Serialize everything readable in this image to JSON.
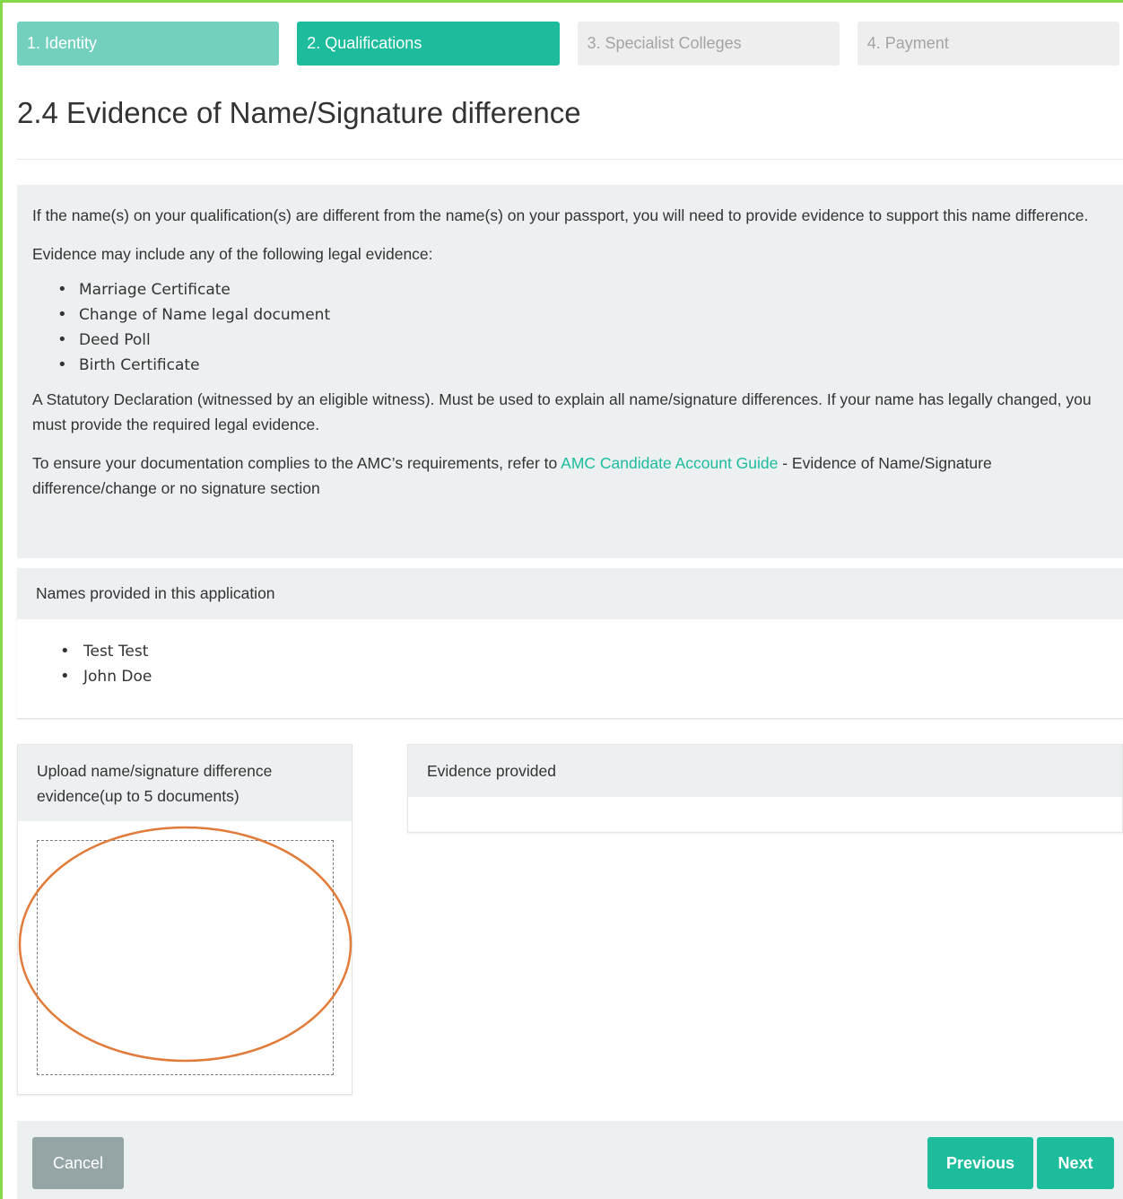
{
  "steps": [
    {
      "label": "1. Identity",
      "state": "done"
    },
    {
      "label": "2. Qualifications",
      "state": "active"
    },
    {
      "label": "3. Specialist Colleges",
      "state": "todo"
    },
    {
      "label": "4. Payment",
      "state": "todo"
    }
  ],
  "page_title": "2.4 Evidence of Name/Signature difference",
  "info": {
    "intro": "If the name(s) on your qualification(s) are different from the name(s) on your passport, you will need to provide evidence to support this name difference.",
    "evidence_lead": "Evidence may include any of the following legal evidence:",
    "evidence_items": [
      "Marriage Certificate",
      "Change of Name legal document",
      "Deed Poll",
      "Birth Certificate"
    ],
    "statutory": "A Statutory Declaration (witnessed by an eligible witness). Must be used to explain all name/signature differences. If your name has legally changed, you must provide the required legal evidence.",
    "guide_prefix": "To ensure your documentation complies to the AMC’s requirements, refer to ",
    "guide_link": "AMC Candidate Account Guide",
    "guide_suffix": " - Evidence of Name/Signature difference/change or no signature section"
  },
  "names_panel": {
    "heading": "Names provided in this application",
    "names": [
      "Test Test",
      "John Doe"
    ]
  },
  "upload_panel": {
    "heading": "Upload name/signature difference evidence(up to 5 documents)"
  },
  "evidence_panel": {
    "heading": "Evidence provided"
  },
  "footer": {
    "cancel_label": "Cancel",
    "previous_label": "Previous",
    "next_label": "Next"
  },
  "colors": {
    "accent": "#1cbc9c",
    "accent_light": "#73d0bd",
    "cancel": "#95a5a6",
    "annotation": "#e07b39"
  }
}
